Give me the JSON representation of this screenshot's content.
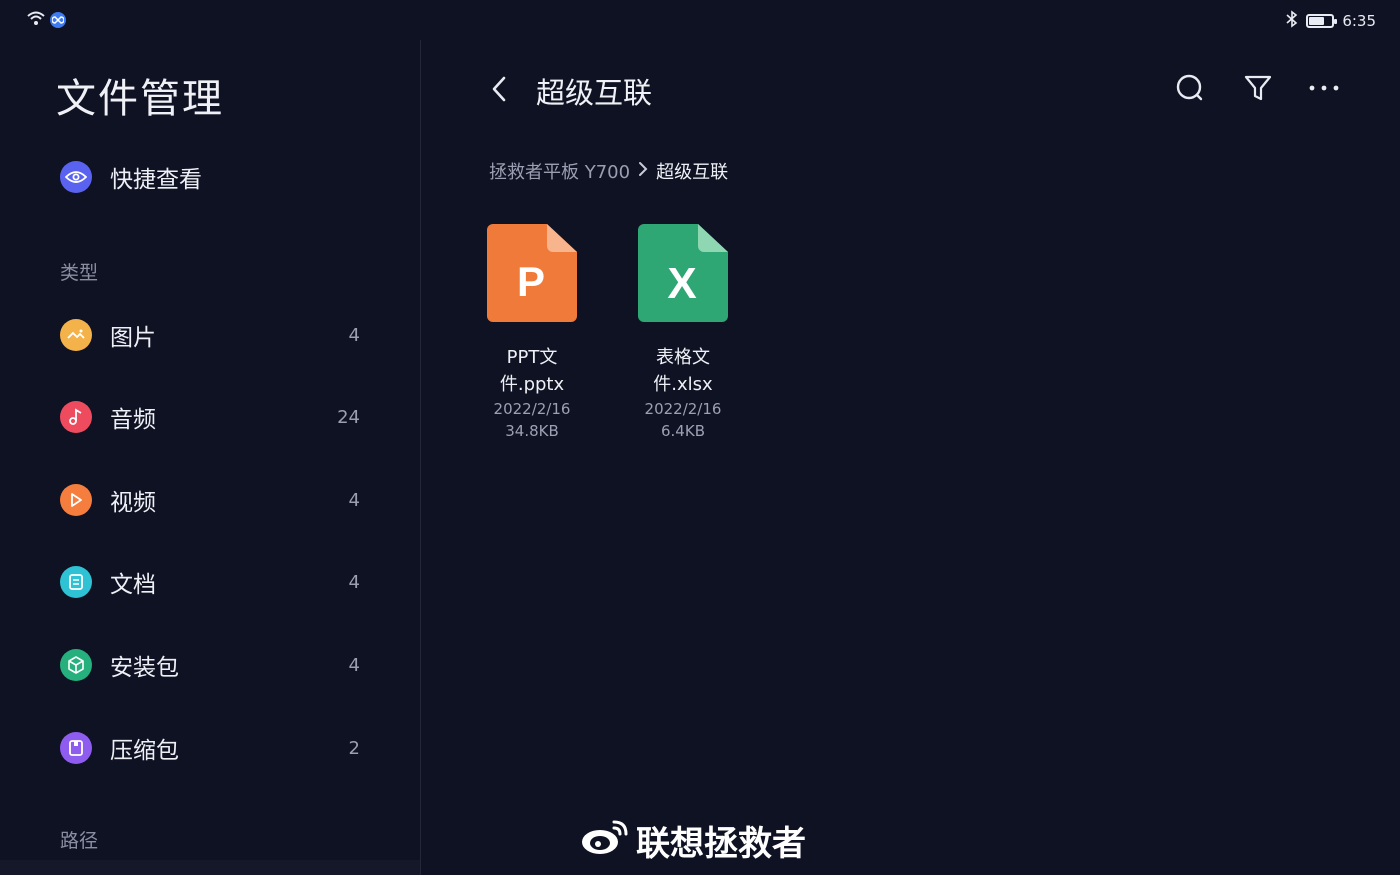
{
  "status_bar": {
    "wifi_icon": "wifi-icon",
    "link_icon": "infinity-icon",
    "bluetooth_icon": "bluetooth-icon",
    "battery_level": 0.7,
    "time": "6:35"
  },
  "sidebar": {
    "title": "文件管理",
    "quick_view": {
      "label": "快捷查看",
      "icon": "eye-icon",
      "color": "#5a63f0"
    },
    "types_header": "类型",
    "categories": [
      {
        "label": "图片",
        "count": "4",
        "icon": "image-icon",
        "color": "#f4b24a"
      },
      {
        "label": "音频",
        "count": "24",
        "icon": "music-note-icon",
        "color": "#ef4b5f"
      },
      {
        "label": "视频",
        "count": "4",
        "icon": "play-icon",
        "color": "#f57d3d"
      },
      {
        "label": "文档",
        "count": "4",
        "icon": "document-icon",
        "color": "#2ec2d4"
      },
      {
        "label": "安装包",
        "count": "4",
        "icon": "package-icon",
        "color": "#25b07d"
      },
      {
        "label": "压缩包",
        "count": "2",
        "icon": "archive-icon",
        "color": "#8f5cf0"
      }
    ],
    "path_header": "路径"
  },
  "main": {
    "title": "超级互联",
    "breadcrumb": {
      "root": "拯救者平板 Y700",
      "current": "超级互联"
    },
    "files": [
      {
        "name_line1": "PPT文",
        "name_line2": "件.pptx",
        "date": "2022/2/16",
        "size": "34.8KB",
        "letter": "P",
        "color": "#f07a3a",
        "fold_color": "#f8b48c",
        "icon": "pptx-file-icon"
      },
      {
        "name_line1": "表格文",
        "name_line2": "件.xlsx",
        "date": "2022/2/16",
        "size": "6.4KB",
        "letter": "X",
        "color": "#2ea774",
        "fold_color": "#8fd6b3",
        "icon": "xlsx-file-icon"
      }
    ]
  },
  "watermark": {
    "text": "联想拯救者",
    "icon": "weibo-icon"
  }
}
